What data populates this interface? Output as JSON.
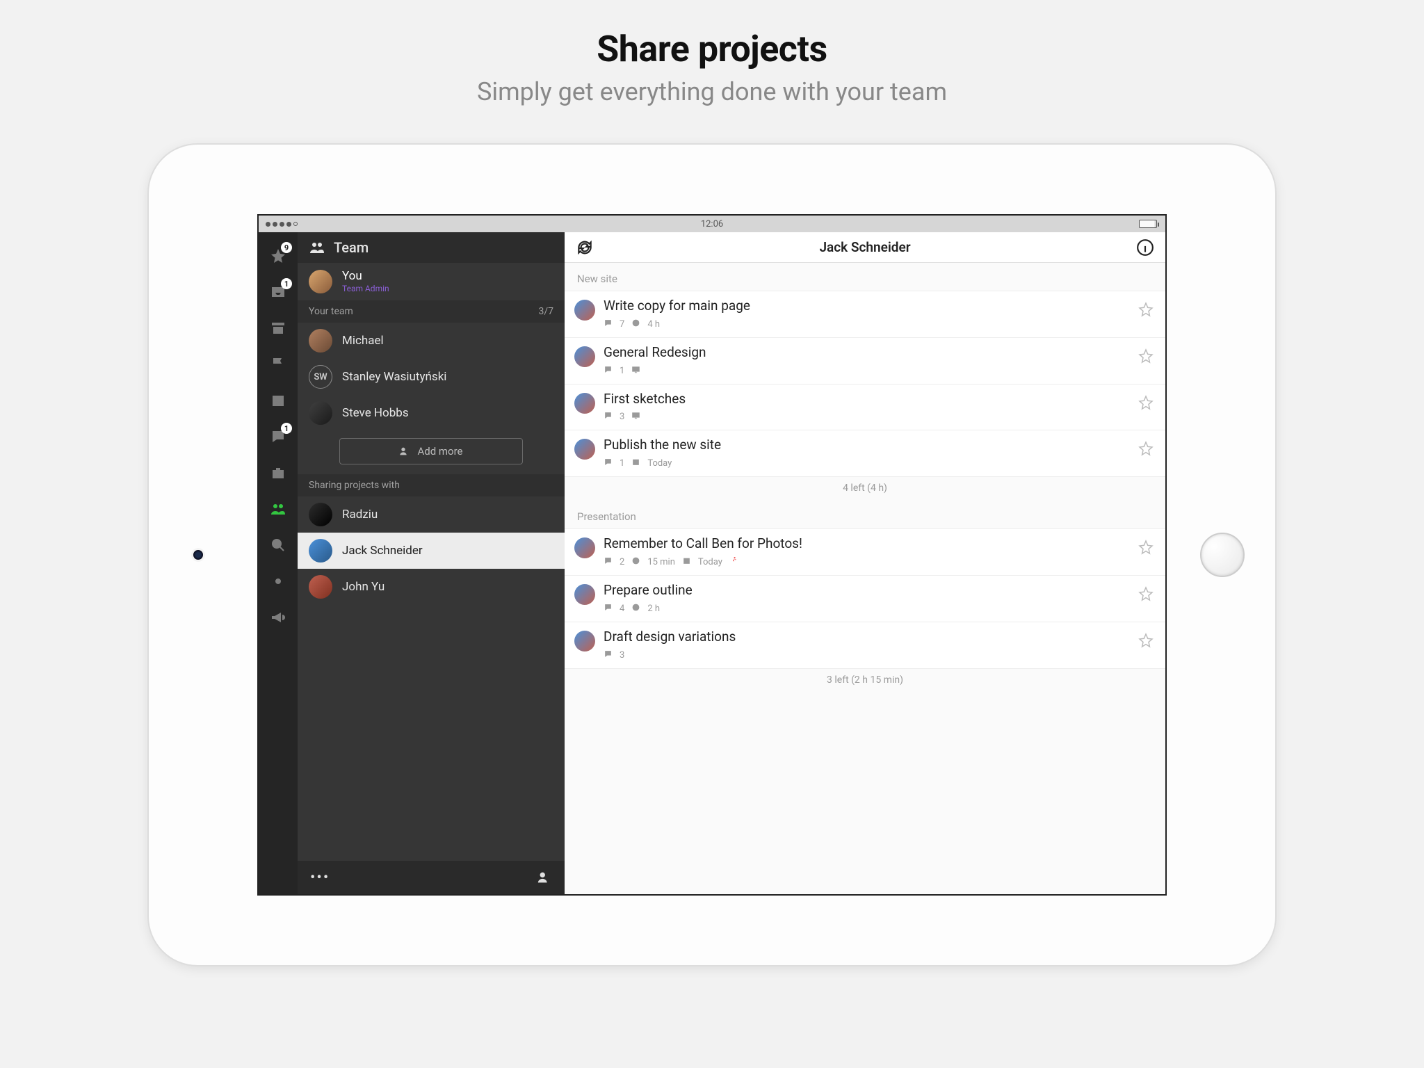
{
  "hero": {
    "title": "Share projects",
    "subtitle": "Simply get everything done with your team"
  },
  "status": {
    "time": "12:06"
  },
  "nav": {
    "badges": {
      "star": "9",
      "inbox": "1",
      "chat": "1"
    }
  },
  "sidebar": {
    "title": "Team",
    "you": {
      "name": "You",
      "role": "Team Admin"
    },
    "team_header": {
      "label": "Your team",
      "count": "3/7"
    },
    "members": [
      {
        "name": "Michael",
        "initials": ""
      },
      {
        "name": "Stanley Wasiutyński",
        "initials": "SW"
      },
      {
        "name": "Steve Hobbs",
        "initials": ""
      }
    ],
    "add_more_label": "Add more",
    "sharing_header": "Sharing projects with",
    "sharing": [
      {
        "name": "Radziu"
      },
      {
        "name": "Jack Schneider"
      },
      {
        "name": "John Yu"
      }
    ]
  },
  "main": {
    "title": "Jack Schneider",
    "groups": [
      {
        "name": "New site",
        "tasks": [
          {
            "title": "Write copy for main page",
            "comments": "7",
            "time": "4 h"
          },
          {
            "title": "General Redesign",
            "comments": "1",
            "screen": true
          },
          {
            "title": "First sketches",
            "comments": "3",
            "screen": true
          },
          {
            "title": "Publish the new site",
            "comments": "1",
            "date": "Today"
          }
        ],
        "footer": "4 left (4 h)"
      },
      {
        "name": "Presentation",
        "tasks": [
          {
            "title": "Remember to Call Ben for Photos!",
            "comments": "2",
            "time": "15 min",
            "date": "Today",
            "urgent": true
          },
          {
            "title": "Prepare outline",
            "comments": "4",
            "time": "2 h"
          },
          {
            "title": "Draft design variations",
            "comments": "3"
          }
        ],
        "footer": "3 left (2 h 15 min)"
      }
    ]
  }
}
